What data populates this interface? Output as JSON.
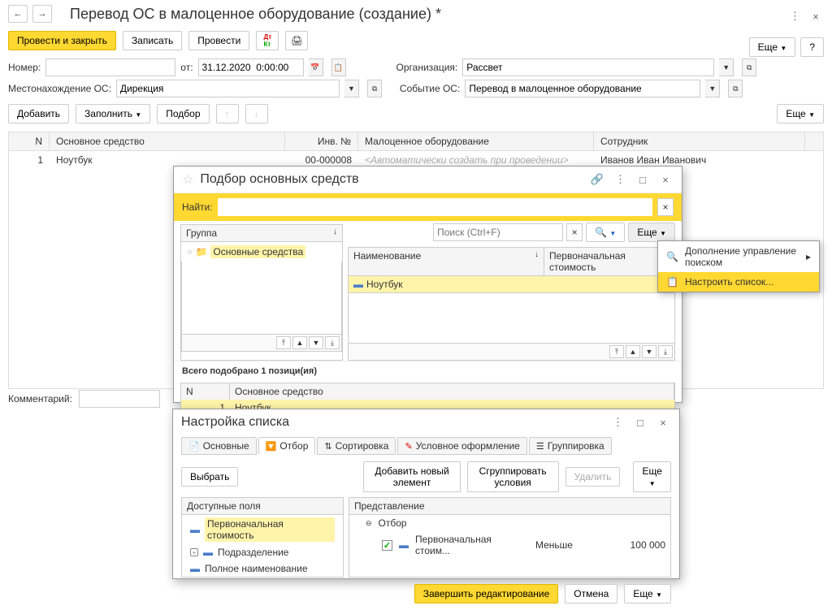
{
  "header": {
    "title": "Перевод ОС в малоценное оборудование (создание) *"
  },
  "toolbar": {
    "post_close": "Провести и закрыть",
    "save": "Записать",
    "post": "Провести",
    "more": "Еще",
    "help": "?"
  },
  "form": {
    "number_label": "Номер:",
    "from_label": "от:",
    "date_value": "31.12.2020  0:00:00",
    "org_label": "Организация:",
    "org_value": "Рассвет",
    "loc_label": "Местонахождение ОС:",
    "loc_value": "Дирекция",
    "event_label": "Событие ОС:",
    "event_value": "Перевод в малоценное оборудование"
  },
  "doc_toolbar": {
    "add": "Добавить",
    "fill": "Заполнить",
    "select": "Подбор",
    "more": "Еще"
  },
  "table": {
    "cols": {
      "n": "N",
      "os": "Основное средство",
      "inv": "Инв. №",
      "mal": "Малоценное оборудование",
      "sotr": "Сотрудник"
    },
    "rows": [
      {
        "n": "1",
        "os": "Ноутбук",
        "inv": "00-000008",
        "mal": "<Автоматически создать при проведении>",
        "sotr": "Иванов Иван Иванович"
      }
    ]
  },
  "comment_label": "Комментарий:",
  "picker": {
    "title": "Подбор основных средств",
    "search_label": "Найти:",
    "group_label": "Группа",
    "tree_root": "Основные средства",
    "poisk_placeholder": "Поиск (Ctrl+F)",
    "more": "Еще",
    "list_cols": {
      "name": "Наименование",
      "cost": "Первоначальная стоимость"
    },
    "list_row": "Ноутбук",
    "summary": "Всего подобрано 1 позици(ия)",
    "picked_cols": {
      "n": "N",
      "os": "Основное средство"
    },
    "picked_row": {
      "n": "1",
      "os": "Ноутбук"
    }
  },
  "menu": {
    "item1": "Дополнение управление поиском",
    "item2": "Настроить список..."
  },
  "settings": {
    "title": "Настройка списка",
    "tabs": {
      "t1": "Основные",
      "t2": "Отбор",
      "t3": "Сортировка",
      "t4": "Условное оформление",
      "t5": "Группировка"
    },
    "toolbar": {
      "select": "Выбрать",
      "add": "Добавить новый элемент",
      "group": "Сгруппировать условия",
      "delete": "Удалить",
      "more": "Еще"
    },
    "avail_label": "Доступные поля",
    "avail": [
      "Первоначальная стоимость",
      "Подразделение",
      "Полное наименование"
    ],
    "filter_label": "Представление",
    "filter_root": "Отбор",
    "filter_field": "Первоначальная стоим...",
    "filter_cond": "Меньше",
    "filter_val": "100 000",
    "footer": {
      "finish": "Завершить редактирование",
      "cancel": "Отмена",
      "more": "Еще"
    }
  }
}
